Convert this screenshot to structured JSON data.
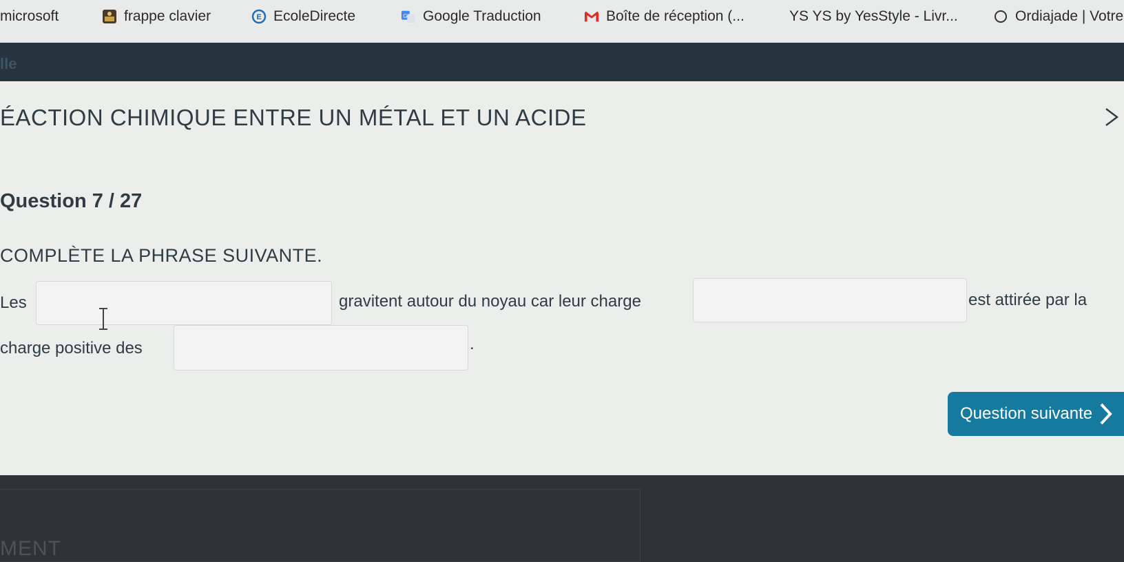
{
  "bookmarks": [
    {
      "label": "microsoft",
      "icon": "none"
    },
    {
      "label": "frappe clavier",
      "icon": "keyboard-app-icon"
    },
    {
      "label": "EcoleDirecte",
      "icon": "ecoledirecte-icon"
    },
    {
      "label": "Google Traduction",
      "icon": "google-translate-icon"
    },
    {
      "label": "Boîte de réception (...",
      "icon": "gmail-icon"
    },
    {
      "label": "YS  YS by YesStyle - Livr...",
      "icon": "none"
    },
    {
      "label": "Ordiajade | Votre",
      "icon": "circle-icon"
    }
  ],
  "header": {
    "crumb": "lle"
  },
  "quiz": {
    "title": "ÉACTION CHIMIQUE ENTRE UN MÉTAL ET UN ACIDE",
    "question_number": "Question 7 / 27",
    "instruction": "COMPLÈTE LA PHRASE SUIVANTE.",
    "sentence": {
      "part1": "Les",
      "part2": "gravitent autour du noyau car leur charge",
      "part3": "est attirée par la",
      "part4": "charge positive des",
      "part5": "."
    },
    "blanks": [
      "",
      "",
      ""
    ],
    "next_button": "Question suivante"
  },
  "footer": {
    "label": "MENT"
  },
  "colors": {
    "accent": "#167a9e",
    "header_band": "#263440",
    "text": "#2f3c44",
    "content_bg": "#eceeec"
  }
}
